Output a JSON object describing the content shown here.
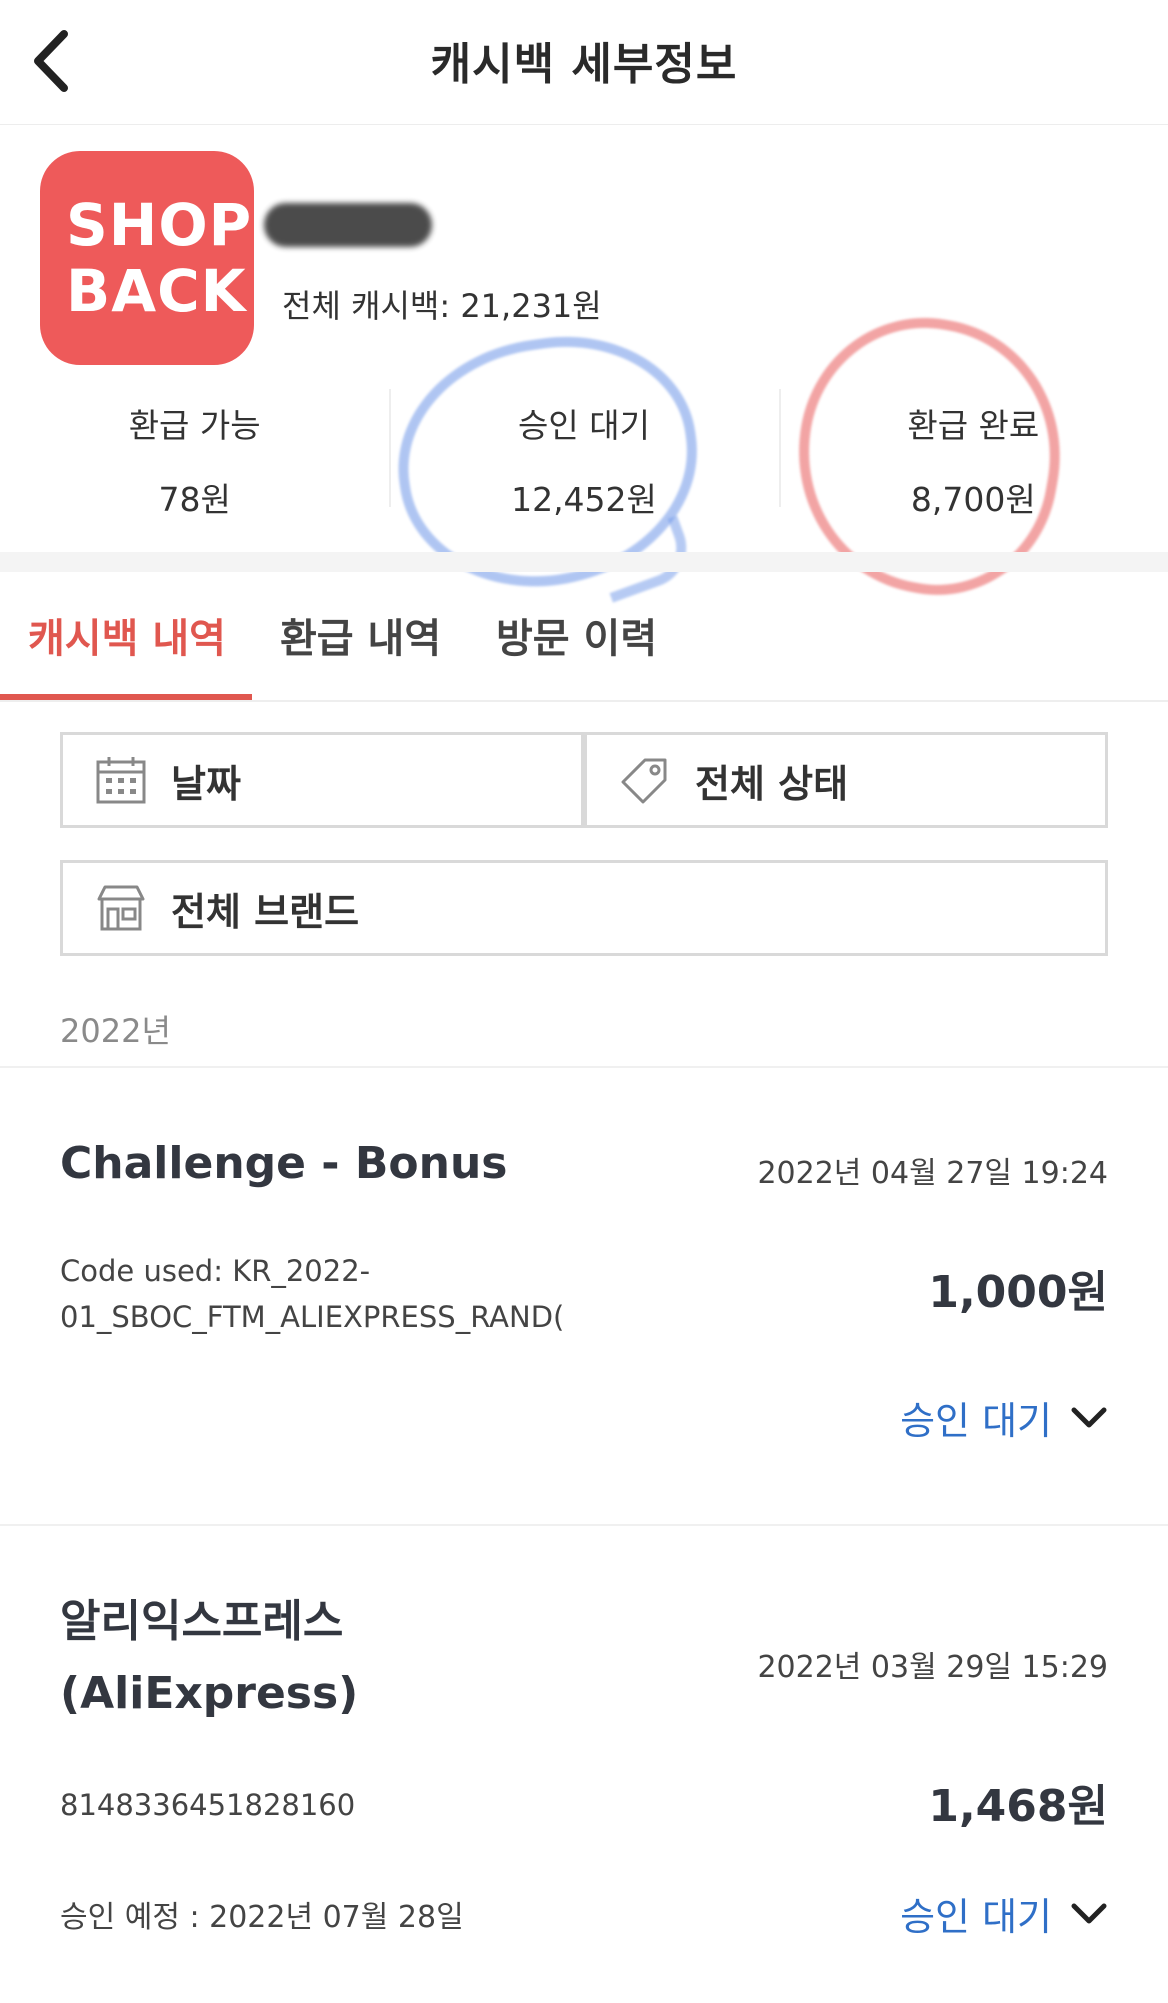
{
  "header": {
    "title": "캐시백 세부정보",
    "back_icon": "chevron-left-icon"
  },
  "summary": {
    "logo_line1": "SHOP",
    "logo_line2": "BACK",
    "logo_color": "#ee5a5a",
    "total_label": "전체 캐시백: 21,231원",
    "stats": [
      {
        "label": "환급 가능",
        "value": "78원"
      },
      {
        "label": "승인 대기",
        "value": "12,452원"
      },
      {
        "label": "환급 완료",
        "value": "8,700원"
      }
    ]
  },
  "tabs": [
    {
      "label": "캐시백 내역",
      "active": true
    },
    {
      "label": "환급 내역",
      "active": false
    },
    {
      "label": "방문 이력",
      "active": false
    }
  ],
  "filters": {
    "date": {
      "label": "날짜",
      "icon": "calendar-icon"
    },
    "status": {
      "label": "전체 상태",
      "icon": "tag-icon"
    },
    "brand": {
      "label": "전체 브랜드",
      "icon": "store-icon"
    }
  },
  "list": {
    "year": "2022년",
    "entries": [
      {
        "title": "Challenge - Bonus",
        "date": "2022년 04월 27일 19:24",
        "sub_line1": "Code used: KR_2022-",
        "sub_line2": "01_SBOC_FTM_ALIEXPRESS_RAND(",
        "amount": "1,000원",
        "status": "승인 대기"
      },
      {
        "title_line1": "알리익스프레스",
        "title_line2": "(AliExpress)",
        "date": "2022년 03월 29일 15:29",
        "sub_line1": "8148336451828160",
        "amount": "1,468원",
        "note": "승인 예정 : 2022년 07월 28일",
        "status": "승인 대기"
      }
    ]
  },
  "colors": {
    "accent": "#e0574f",
    "status_blue": "#2f6fc7",
    "marker_blue": "#6f97e8",
    "marker_red": "#e85a5a"
  }
}
